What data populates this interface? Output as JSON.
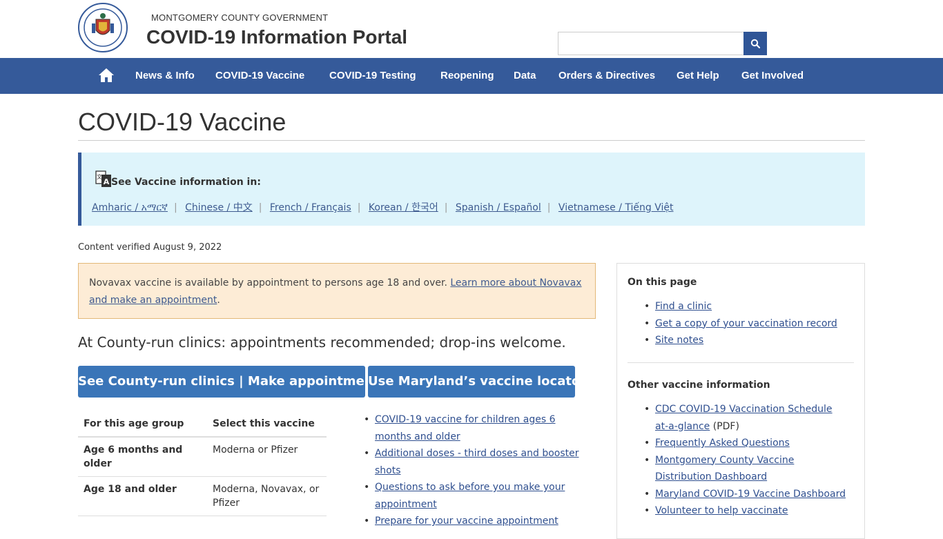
{
  "header": {
    "org_name": "MONTGOMERY COUNTY GOVERNMENT",
    "portal_title": "COVID-19 Information Portal",
    "search": {
      "value": "",
      "placeholder": ""
    },
    "seal_text": "MONTGOMERY COUNTY MARYLAND 1776"
  },
  "nav": {
    "items": [
      {
        "label": "News & Info"
      },
      {
        "label": "COVID-19 Vaccine"
      },
      {
        "label": "COVID-19 Testing"
      },
      {
        "label": "Reopening"
      },
      {
        "label": "Data"
      },
      {
        "label": "Orders & Directives"
      },
      {
        "label": "Get Help"
      },
      {
        "label": "Get Involved"
      }
    ]
  },
  "page": {
    "title": "COVID-19 Vaccine",
    "language_box": {
      "heading": "See Vaccine information in:",
      "links": [
        "Amharic / አማርኛ",
        "Chinese / 中文",
        "French / Français",
        "Korean / 한국어",
        "Spanish / Español",
        "Vietnamese / Tiếng Việt"
      ],
      "separator": "|"
    },
    "verified": "Content verified August 9, 2022",
    "alert": {
      "text": "Novavax vaccine is available by appointment to persons age 18 and over. ",
      "link": "Learn more about Novavax and make an appointment",
      "suffix": "."
    },
    "appointments_line": "At County-run clinics: appointments recommended; drop-ins welcome.",
    "buttons": {
      "clinics": "See County-run clinics | Make appointments",
      "locator": "Use Maryland’s vaccine locator"
    },
    "table": {
      "headers": [
        "For this age group",
        "Select this vaccine"
      ],
      "rows": [
        {
          "age": "Age 6 months and older",
          "vaccine": "Moderna or Pfizer"
        },
        {
          "age": "Age 18 and older",
          "vaccine": "Moderna, Novavax, or Pfizer"
        }
      ]
    },
    "vaccine_links": [
      "COVID-19 vaccine for children ages 6 months and older",
      "Additional doses - third doses and booster shots",
      "Questions to ask before you make your appointment",
      "Prepare for your vaccine appointment"
    ]
  },
  "sidebar": {
    "on_this_page": {
      "heading": "On this page",
      "links": [
        "Find a clinic",
        "Get a copy of your vaccination record",
        "Site notes"
      ]
    },
    "other_info": {
      "heading": "Other vaccine information",
      "links": [
        {
          "label": "CDC COVID-19 Vaccination Schedule at-a-glance",
          "suffix": " (PDF)"
        },
        {
          "label": "Frequently Asked Questions",
          "suffix": ""
        },
        {
          "label": "Montgomery County Vaccine Distribution Dashboard",
          "suffix": ""
        },
        {
          "label": "Maryland COVID-19 Vaccine Dashboard",
          "suffix": ""
        },
        {
          "label": "Volunteer to help vaccinate",
          "suffix": ""
        }
      ]
    }
  },
  "colors": {
    "nav_bg": "#355a9a",
    "button_bg": "#3a75b8",
    "lang_box_bg": "#def4fb",
    "alert_bg": "#fdecd6",
    "link": "#3d5a8f"
  },
  "icons": [
    "seal-icon",
    "search-icon",
    "home-icon",
    "translate-icon"
  ]
}
